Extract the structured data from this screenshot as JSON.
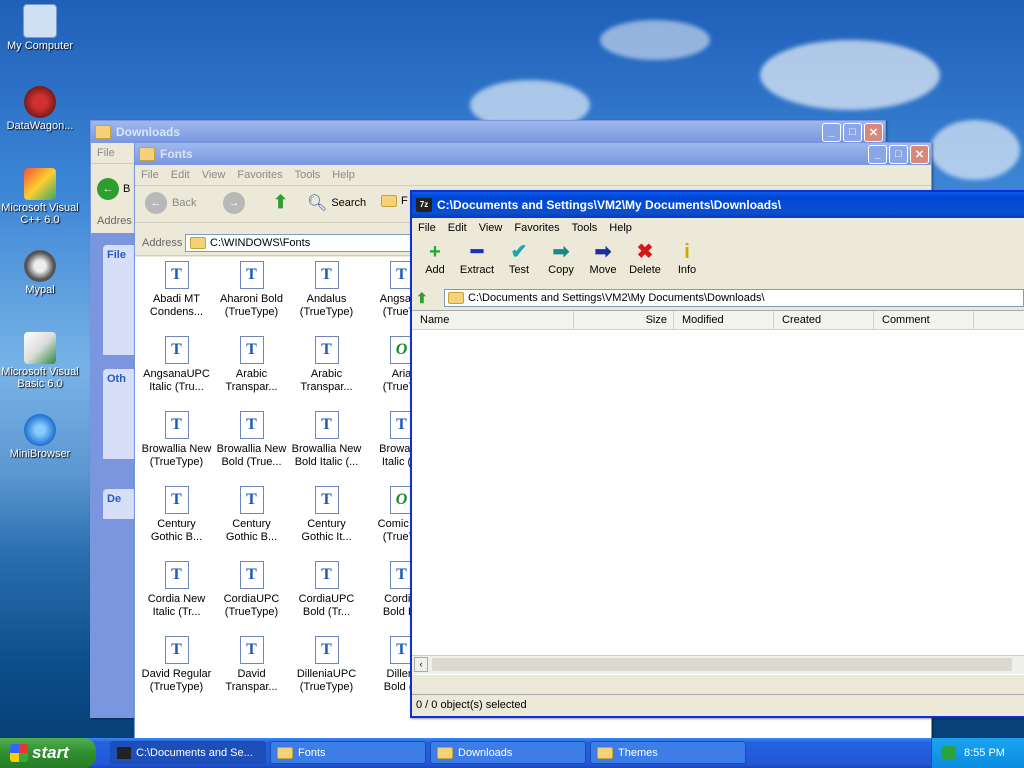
{
  "desktop": {
    "icons": [
      {
        "label": "My Computer"
      },
      {
        "label": "DataWagon..."
      },
      {
        "label": "Microsoft Visual C++ 6.0"
      },
      {
        "label": "Mypal"
      },
      {
        "label": "Microsoft Visual Basic 6.0"
      },
      {
        "label": "MiniBrowser"
      }
    ]
  },
  "downloads_window": {
    "title": "Downloads",
    "menu": {
      "file": "File"
    },
    "address_label": "Addres",
    "back_label": "B",
    "panel_labels": [
      "File",
      "Oth",
      "De"
    ]
  },
  "fonts_window": {
    "title": "Fonts",
    "menu": [
      "File",
      "Edit",
      "View",
      "Favorites",
      "Tools",
      "Help"
    ],
    "toolbar": {
      "back": "Back",
      "search": "Search",
      "folders": "F"
    },
    "address_label": "Address",
    "address_value": "C:\\WINDOWS\\Fonts",
    "fonts": [
      [
        "Abadi MT",
        "Condens..."
      ],
      [
        "Aharoni Bold",
        "(TrueType)"
      ],
      [
        "Andalus",
        "(TrueType)"
      ],
      [
        "Angsana",
        "(TrueTy"
      ],
      [
        "AngsanaUPC",
        "Italic (Tru..."
      ],
      [
        "Arabic",
        "Transpar..."
      ],
      [
        "Arabic",
        "Transpar..."
      ],
      [
        "Aria",
        "(TrueTy"
      ],
      [
        "Browallia New",
        "(TrueType)"
      ],
      [
        "Browallia New",
        "Bold (True..."
      ],
      [
        "Browallia New",
        "Bold Italic (..."
      ],
      [
        "Browallia",
        "Italic (Tr"
      ],
      [
        "Century",
        "Gothic B..."
      ],
      [
        "Century",
        "Gothic B..."
      ],
      [
        "Century",
        "Gothic It..."
      ],
      [
        "Comic Sa",
        "(TrueTy"
      ],
      [
        "Cordia New",
        "Italic (Tr..."
      ],
      [
        "CordiaUPC",
        "(TrueType)"
      ],
      [
        "CordiaUPC",
        "Bold (Tr..."
      ],
      [
        "Cordial",
        "Bold Ita"
      ],
      [
        "David Regular",
        "(TrueType)"
      ],
      [
        "David",
        "Transpar..."
      ],
      [
        "DilleniaUPC",
        "(TrueType)"
      ],
      [
        "Dilleni",
        "Bold (T"
      ]
    ]
  },
  "zip_window": {
    "title": "C:\\Documents and Settings\\VM2\\My Documents\\Downloads\\",
    "menu": [
      "File",
      "Edit",
      "View",
      "Favorites",
      "Tools",
      "Help"
    ],
    "toolbar": [
      {
        "label": "Add",
        "glyph": "+",
        "color": "#1fa82a"
      },
      {
        "label": "Extract",
        "glyph": "━",
        "color": "#1a2fbf"
      },
      {
        "label": "Test",
        "glyph": "✔",
        "color": "#1aa6b0"
      },
      {
        "label": "Copy",
        "glyph": "➡",
        "color": "#178a8a"
      },
      {
        "label": "Move",
        "glyph": "➡",
        "color": "#1a2f9c"
      },
      {
        "label": "Delete",
        "glyph": "✖",
        "color": "#d41818"
      },
      {
        "label": "Info",
        "glyph": "i",
        "color": "#d4a600"
      }
    ],
    "path": "C:\\Documents and Settings\\VM2\\My Documents\\Downloads\\",
    "columns": [
      "Name",
      "Size",
      "Modified",
      "Created",
      "Comment"
    ],
    "status": "0 / 0 object(s) selected"
  },
  "taskbar": {
    "start_label": "start",
    "items": [
      {
        "label": "C:\\Documents and Se..."
      },
      {
        "label": "Fonts"
      },
      {
        "label": "Downloads"
      },
      {
        "label": "Themes"
      }
    ],
    "clock": "8:55 PM"
  }
}
